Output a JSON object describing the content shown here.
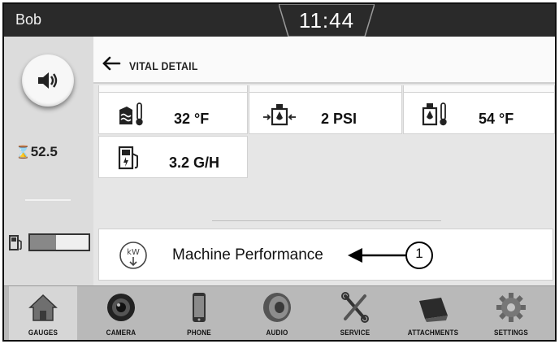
{
  "topbar": {
    "user": "Bob",
    "time": "11:44"
  },
  "left": {
    "hour_meter": "52.5",
    "hour_meter_icon": "hourglass-icon",
    "volume_icon": "speaker-icon",
    "fuel_icon": "fuel-pump-icon",
    "fuel_level": 0.45
  },
  "header": {
    "title": "VITAL DETAIL",
    "back_icon": "back-arrow-icon"
  },
  "tiles": [
    {
      "icon": "coolant-temp-icon",
      "value": "32 °F"
    },
    {
      "icon": "oil-pressure-icon",
      "value": "2 PSI"
    },
    {
      "icon": "hydraulic-temp-icon",
      "value": "54 °F"
    },
    {
      "icon": "fuel-rate-icon",
      "value": "3.2 G/H"
    }
  ],
  "performance": {
    "label": "Machine Performance",
    "icon": "kw-icon",
    "callout": "1"
  },
  "nav": [
    {
      "label": "GAUGES",
      "icon": "house-icon",
      "active": true
    },
    {
      "label": "CAMERA",
      "icon": "camera-icon"
    },
    {
      "label": "PHONE",
      "icon": "phone-icon"
    },
    {
      "label": "AUDIO",
      "icon": "speaker-audio-icon"
    },
    {
      "label": "SERVICE",
      "icon": "wrench-icon"
    },
    {
      "label": "ATTACHMENTS",
      "icon": "bucket-icon"
    },
    {
      "label": "SETTINGS",
      "icon": "gear-icon"
    }
  ]
}
